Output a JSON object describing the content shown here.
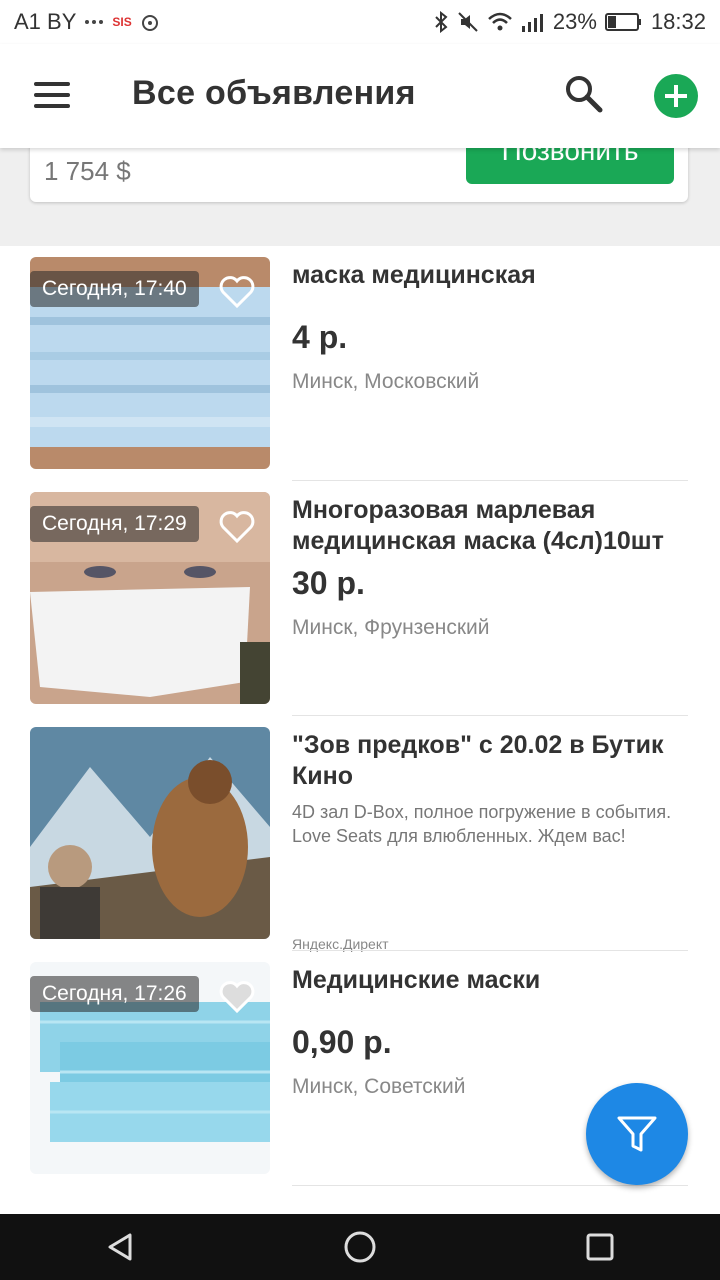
{
  "status_bar": {
    "carrier": "A1 BY",
    "battery": "23%",
    "time": "18:32"
  },
  "app_bar": {
    "title": "Все объявления"
  },
  "top_card": {
    "price": "1 754 $",
    "call_label": "Позвонить"
  },
  "listings": [
    {
      "time": "Сегодня, 17:40",
      "title": "маска медицинская",
      "price": "4 р.",
      "location": "Минск, Московский"
    },
    {
      "time": "Сегодня, 17:29",
      "title": "Многоразовая марлевая медицинская маска (4сл)10шт",
      "price": "30 р.",
      "location": "Минск, Фрунзенский"
    },
    {
      "time": "Сегодня, 17:26",
      "title": "Медицинские маски",
      "price": "0,90 р.",
      "location": "Минск, Советский"
    }
  ],
  "ad": {
    "title": "\"Зов предков\" с 20.02 в Бутик Кино",
    "description": "4D зал D-Box, полное погружение в события. Love Seats для влюбленных. Ждем вас!",
    "source": "Яндекс.Директ"
  },
  "colors": {
    "accent_green": "#1aa856",
    "fab_blue": "#1e88e5"
  },
  "icons": {
    "menu": "menu-icon",
    "search": "search-icon",
    "add": "plus-icon",
    "favorite": "heart-icon",
    "filter": "filter-icon",
    "nav_back": "back-triangle-icon",
    "nav_home": "home-circle-icon",
    "nav_recents": "recents-square-icon"
  }
}
